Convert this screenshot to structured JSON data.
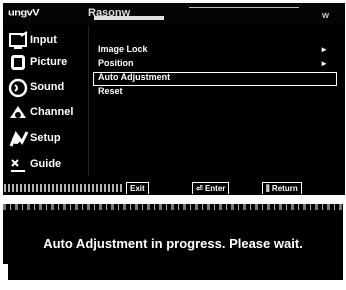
{
  "osd": {
    "header": {
      "left_text": "ungvV",
      "mid_text": "Rasonw",
      "right_text": "w"
    },
    "categories": [
      {
        "label": "Input",
        "icon": "input-icon"
      },
      {
        "label": "Picture",
        "icon": "picture-icon"
      },
      {
        "label": "Sound",
        "icon": "sound-icon"
      },
      {
        "label": "Channel",
        "icon": "channel-icon"
      },
      {
        "label": "Setup",
        "icon": "setup-icon"
      },
      {
        "label": "Guide",
        "icon": "guide-icon"
      }
    ],
    "items": [
      {
        "label": "Image Lock",
        "arrow": "►"
      },
      {
        "label": "Position",
        "arrow": "►"
      },
      {
        "label": "Auto Adjustment",
        "arrow": ""
      },
      {
        "label": "Reset",
        "arrow": ""
      }
    ],
    "footer": {
      "exit_label": "Exit",
      "enter_label": "Enter",
      "return_label": "Return"
    }
  },
  "message": {
    "text": "Auto Adjustment in progress. Please wait."
  }
}
